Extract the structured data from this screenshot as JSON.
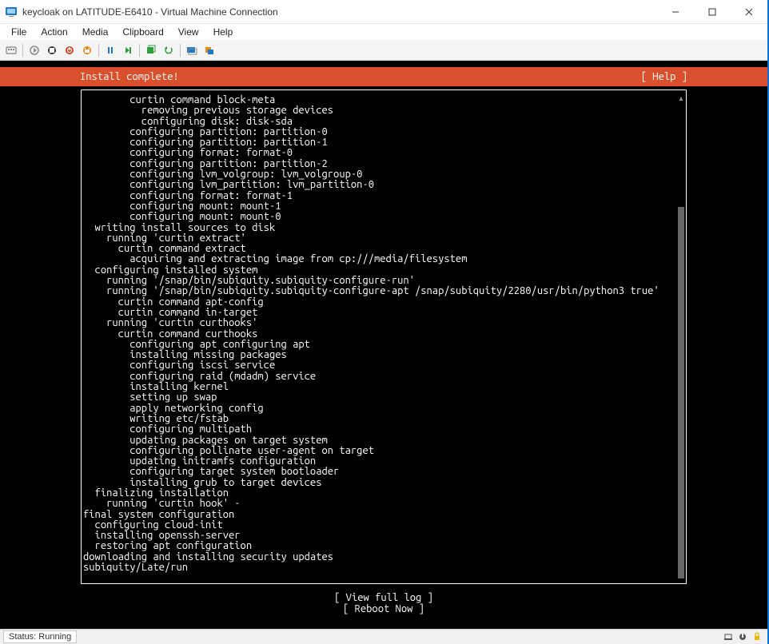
{
  "window": {
    "title": "keycloak on LATITUDE-E6410 - Virtual Machine Connection"
  },
  "menu": {
    "file": "File",
    "action": "Action",
    "media": "Media",
    "clipboard": "Clipboard",
    "view": "View",
    "help": "Help"
  },
  "installer": {
    "title": "Install complete!",
    "help": "[ Help ]"
  },
  "log_lines": [
    "        curtin command block-meta",
    "          removing previous storage devices",
    "          configuring disk: disk-sda",
    "        configuring partition: partition-0",
    "        configuring partition: partition-1",
    "        configuring format: format-0",
    "        configuring partition: partition-2",
    "        configuring lvm_volgroup: lvm_volgroup-0",
    "        configuring lvm_partition: lvm_partition-0",
    "        configuring format: format-1",
    "        configuring mount: mount-1",
    "        configuring mount: mount-0",
    "  writing install sources to disk",
    "    running 'curtin extract'",
    "      curtin command extract",
    "        acquiring and extracting image from cp:///media/filesystem",
    "  configuring installed system",
    "    running '/snap/bin/subiquity.subiquity-configure-run'",
    "    running '/snap/bin/subiquity.subiquity-configure-apt /snap/subiquity/2280/usr/bin/python3 true'",
    "      curtin command apt-config",
    "      curtin command in-target",
    "    running 'curtin curthooks'",
    "      curtin command curthooks",
    "        configuring apt configuring apt",
    "        installing missing packages",
    "        configuring iscsi service",
    "        configuring raid (mdadm) service",
    "        installing kernel",
    "        setting up swap",
    "        apply networking config",
    "        writing etc/fstab",
    "        configuring multipath",
    "        updating packages on target system",
    "        configuring pollinate user-agent on target",
    "        updating initramfs configuration",
    "        configuring target system bootloader",
    "        installing grub to target devices",
    "  finalizing installation",
    "    running 'curtin hook' -",
    "final system configuration",
    "  configuring cloud-init",
    "  installing openssh-server",
    "  restoring apt configuration",
    "downloading and installing security updates",
    "subiquity/Late/run"
  ],
  "actions": {
    "view_full_log": "[ View full log ]",
    "reboot_now": "[ Reboot Now    ]"
  },
  "status": {
    "text": "Status: Running"
  },
  "toolbar_icons": [
    "ctrl-alt-del-icon",
    "start-icon",
    "turnoff-icon",
    "shutdown-icon",
    "save-icon",
    "pause-icon",
    "reset-icon",
    "checkpoint-icon",
    "revert-icon",
    "enhanced-session-icon",
    "share-icon"
  ],
  "colors": {
    "accent": "#d9512c",
    "toolbar_red": "#d13f1f",
    "toolbar_orange": "#e68a1e",
    "toolbar_green": "#2e9e3f",
    "toolbar_blue": "#1f78c8"
  }
}
